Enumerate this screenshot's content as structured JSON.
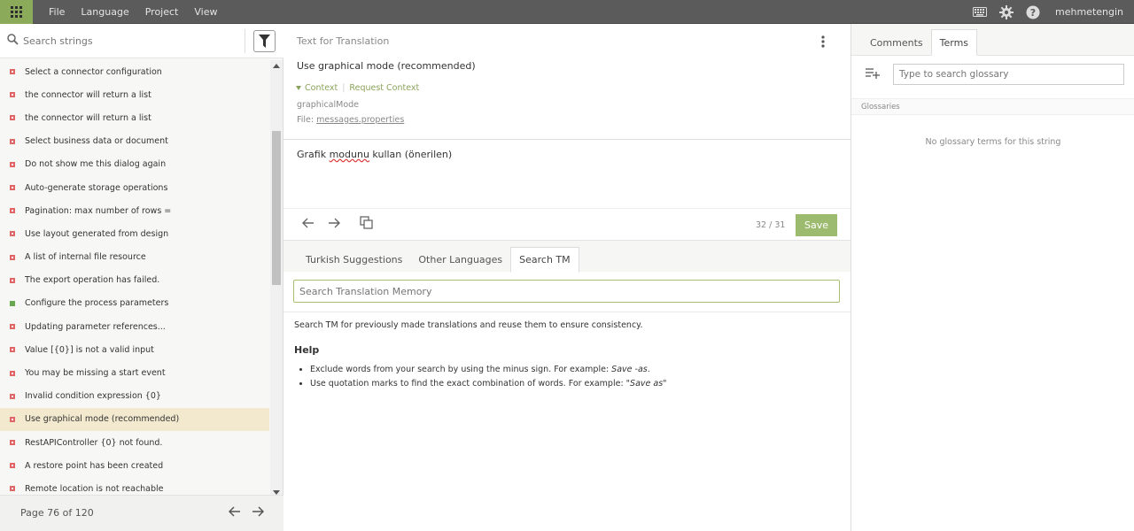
{
  "menu": [
    "File",
    "Language",
    "Project",
    "View"
  ],
  "user": "mehmetengin",
  "sidebar": {
    "search_placeholder": "Search strings",
    "strings": [
      {
        "text": "Select a connector configuration",
        "status": "red"
      },
      {
        "text": "the connector will return a list",
        "status": "red"
      },
      {
        "text": "the connector will return a list",
        "status": "red"
      },
      {
        "text": "Select business data or document",
        "status": "red"
      },
      {
        "text": "Do not show me this dialog again",
        "status": "red"
      },
      {
        "text": "Auto-generate storage operations",
        "status": "red"
      },
      {
        "text": "Pagination: max number of rows =",
        "status": "red"
      },
      {
        "text": "Use layout generated from design",
        "status": "red"
      },
      {
        "text": "A list of internal file resource",
        "status": "red"
      },
      {
        "text": "The export operation has failed.",
        "status": "red"
      },
      {
        "text": "Configure the process parameters",
        "status": "green"
      },
      {
        "text": "Updating parameter references...",
        "status": "red"
      },
      {
        "text": "Value [{0}] is not a valid input",
        "status": "red"
      },
      {
        "text": "You may be missing a start event",
        "status": "red"
      },
      {
        "text": "Invalid condition expression {0}",
        "status": "red"
      },
      {
        "text": "Use graphical mode (recommended)",
        "status": "red",
        "active": true
      },
      {
        "text": "RestAPIController {0} not found.",
        "status": "red"
      },
      {
        "text": "A restore point has been created",
        "status": "red"
      },
      {
        "text": "Remote location is not reachable",
        "status": "red"
      }
    ],
    "page_label": "Page 76 of 120"
  },
  "editor": {
    "source_label": "Text for Translation",
    "source_text": "Use graphical mode (recommended)",
    "context_label": "Context",
    "request_context_label": "Request Context",
    "context_key": "graphicalMode",
    "file_prefix": "File:",
    "file_name": "messages.properties",
    "translation_before": "Grafik ",
    "translation_misspelled": "modunu",
    "translation_after": " kullan (önerilen)",
    "counter": "32 / 31",
    "save_label": "Save"
  },
  "bottom_tabs": [
    "Turkish Suggestions",
    "Other Languages",
    "Search TM"
  ],
  "tm": {
    "placeholder": "Search Translation Memory",
    "info": "Search TM for previously made translations and reuse them to ensure consistency.",
    "help_title": "Help",
    "help_item1_text": "Exclude words from your search by using the minus sign. For example: ",
    "help_item1_example": "Save -as",
    "help_item1_end": ".",
    "help_item2_text": "Use quotation marks to find the exact combination of words. For example: ",
    "help_item2_example": "\"Save as\""
  },
  "right": {
    "tabs": [
      "Comments",
      "Terms"
    ],
    "glossary_placeholder": "Type to search glossary",
    "glossaries_label": "Glossaries",
    "no_terms": "No glossary terms for this string"
  },
  "colors": {
    "accent": "#8bab5b",
    "save": "#9dbb6f",
    "topbar": "#5b5b5b",
    "missing": "#e06666",
    "done": "#6aa84f",
    "active_row": "#f2e9cf"
  }
}
